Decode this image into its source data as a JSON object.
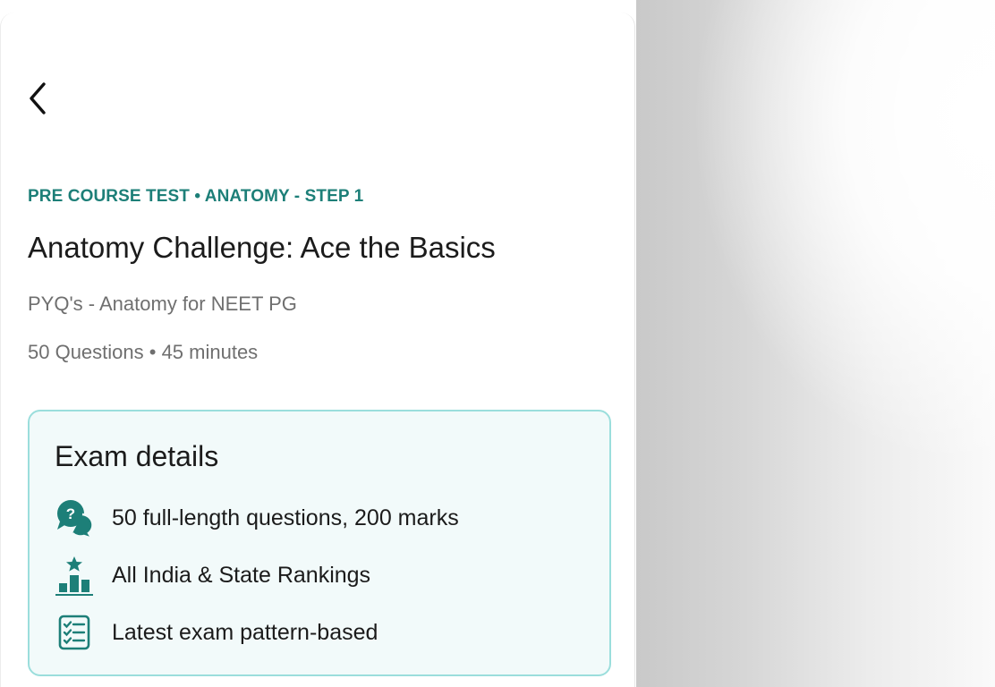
{
  "header": {
    "back_icon": "chevron-left-icon"
  },
  "test": {
    "eyebrow": "PRE COURSE TEST • ANATOMY - STEP 1",
    "title": "Anatomy Challenge: Ace the Basics",
    "subtitle": "PYQ's - Anatomy for NEET PG",
    "meta": "50 Questions • 45 minutes"
  },
  "exam_details": {
    "title": "Exam details",
    "features": [
      {
        "icon": "question-chat-icon",
        "text": "50 full-length questions, 200 marks"
      },
      {
        "icon": "podium-rankings-icon",
        "text": "All India & State Rankings"
      },
      {
        "icon": "checklist-icon",
        "text": "Latest exam pattern-based"
      }
    ]
  },
  "colors": {
    "accent": "#1d7f78",
    "card_border": "#9bdedc",
    "card_bg": "#f2fafa",
    "text_primary": "#1b1b1b",
    "text_secondary": "#6f6f6f"
  }
}
